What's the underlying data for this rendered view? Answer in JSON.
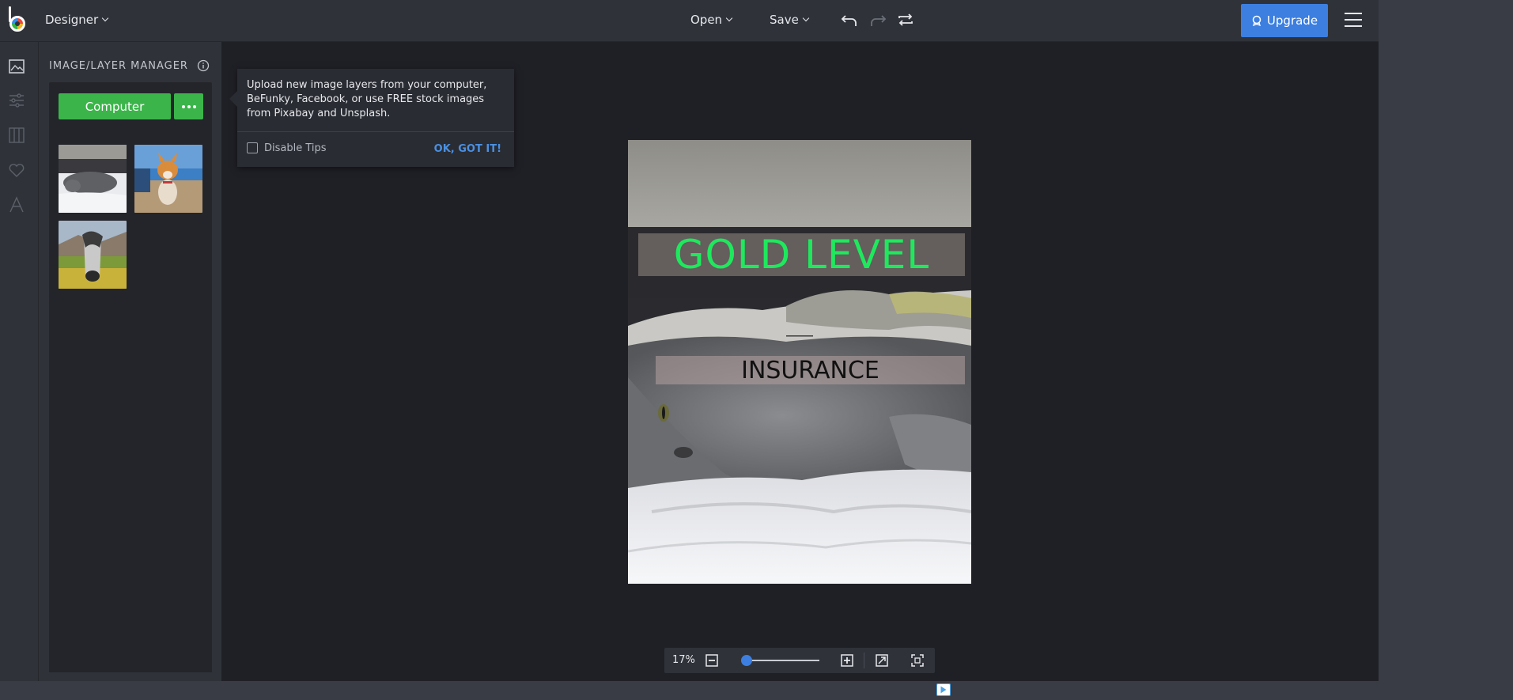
{
  "app": {
    "mode_label": "Designer"
  },
  "toolbar": {
    "open_label": "Open",
    "save_label": "Save",
    "upgrade_label": "Upgrade"
  },
  "panel": {
    "title": "IMAGE/LAYER MANAGER",
    "computer_button": "Computer"
  },
  "tip": {
    "text": "Upload new image layers from your computer, BeFunky, Facebook, or use FREE stock images from Pixabay and Unsplash.",
    "disable_label": "Disable Tips",
    "ok_label": "OK, GOT IT!"
  },
  "document": {
    "headline": "GOLD LEVEL",
    "subheadline": "INSURANCE",
    "headline_color": "#1ee95d"
  },
  "zoom": {
    "percent_label": "17%",
    "slider_fraction": 0.0
  },
  "icons": {
    "rail": [
      "image-icon",
      "sliders-icon",
      "columns-icon",
      "heart-icon",
      "text-icon"
    ],
    "toolbar": [
      "undo-icon",
      "redo-icon",
      "swap-icon"
    ]
  },
  "colors": {
    "accent_blue": "#3c7fe1",
    "accent_green": "#3bb54a"
  }
}
